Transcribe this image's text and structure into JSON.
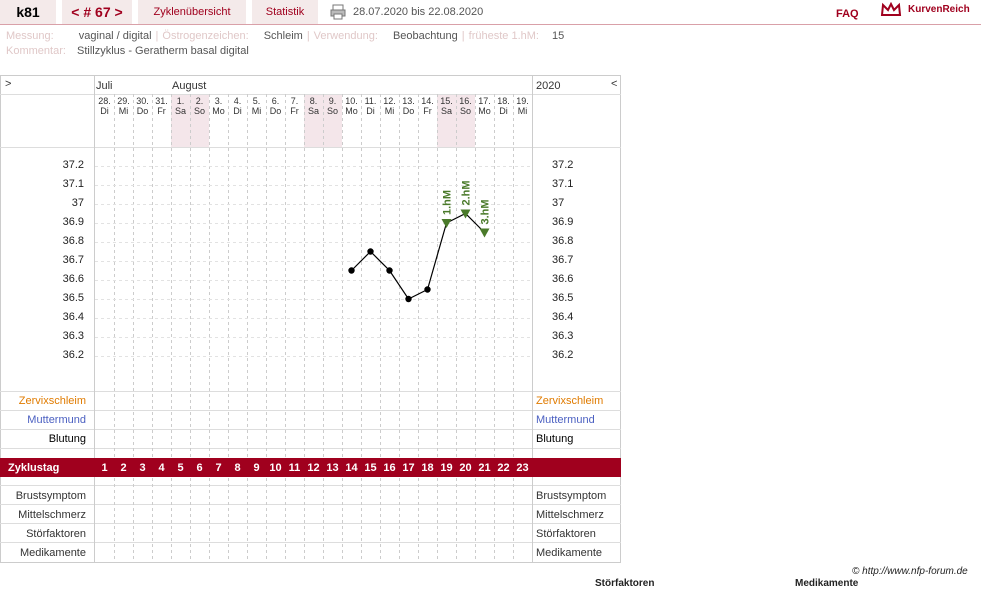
{
  "nav": {
    "user": "k81",
    "cycle": "< # 67 >",
    "tab_overview": "Zyklenübersicht",
    "tab_stats": "Statistik",
    "date_range": "28.07.2020 bis 22.08.2020",
    "faq": "FAQ",
    "brand": "KurvenReich"
  },
  "info": {
    "messung_label": "Messung:",
    "messung_value": "vaginal / digital",
    "oestrogen_label": "Östrogenzeichen:",
    "oestrogen_value": "Schleim",
    "verwendung_label": "Verwendung:",
    "verwendung_value": "Beobachtung",
    "frueheste_label": "früheste 1.hM:",
    "frueheste_value": "15",
    "kommentar_label": "Kommentar:",
    "kommentar_value": "Stillzyklus - Geratherm basal digital"
  },
  "chart_header": {
    "left_arrow": ">",
    "right_arrow": "<",
    "year": "2020",
    "month1": "Juli",
    "month2": "August"
  },
  "days": [
    {
      "d": "28.",
      "w": "Di"
    },
    {
      "d": "29.",
      "w": "Mi"
    },
    {
      "d": "30.",
      "w": "Do"
    },
    {
      "d": "31.",
      "w": "Fr"
    },
    {
      "d": "1.",
      "w": "Sa"
    },
    {
      "d": "2.",
      "w": "So"
    },
    {
      "d": "3.",
      "w": "Mo"
    },
    {
      "d": "4.",
      "w": "Di"
    },
    {
      "d": "5.",
      "w": "Mi"
    },
    {
      "d": "6.",
      "w": "Do"
    },
    {
      "d": "7.",
      "w": "Fr"
    },
    {
      "d": "8.",
      "w": "Sa"
    },
    {
      "d": "9.",
      "w": "So"
    },
    {
      "d": "10.",
      "w": "Mo"
    },
    {
      "d": "11.",
      "w": "Di"
    },
    {
      "d": "12.",
      "w": "Mi"
    },
    {
      "d": "13.",
      "w": "Do"
    },
    {
      "d": "14.",
      "w": "Fr"
    },
    {
      "d": "15.",
      "w": "Sa"
    },
    {
      "d": "16.",
      "w": "So"
    },
    {
      "d": "17.",
      "w": "Mo"
    },
    {
      "d": "18.",
      "w": "Di"
    },
    {
      "d": "19.",
      "w": "Mi"
    }
  ],
  "chart_data": {
    "type": "line",
    "ylim": [
      36.1,
      37.3
    ],
    "yticks": [
      "37.2",
      "37.1",
      "37",
      "36.9",
      "36.8",
      "36.7",
      "36.6",
      "36.5",
      "36.4",
      "36.3",
      "36.2"
    ],
    "cycle_days": [
      14,
      15,
      16,
      17,
      18,
      19,
      20,
      21
    ],
    "temperatures": [
      36.65,
      36.75,
      36.65,
      36.5,
      36.55,
      36.9,
      36.95,
      36.85
    ],
    "high_markers": [
      {
        "cycle_day": 19,
        "label": "1.hM"
      },
      {
        "cycle_day": 20,
        "label": "2.hM"
      },
      {
        "cycle_day": 21,
        "label": "3.hM"
      }
    ],
    "colors": {
      "line": "#000000",
      "marker": "#4a7a2a",
      "label": "#4a7a2a"
    }
  },
  "rows": {
    "zervix": "Zervixschleim",
    "muttermund": "Muttermund",
    "blutung": "Blutung",
    "zyklustag": "Zyklustag",
    "brust": "Brustsymptom",
    "mittel": "Mittelschmerz",
    "stoer": "Störfaktoren",
    "medi": "Medikamente"
  },
  "zyklustage": [
    "1",
    "2",
    "3",
    "4",
    "5",
    "6",
    "7",
    "8",
    "9",
    "10",
    "11",
    "12",
    "13",
    "14",
    "15",
    "16",
    "17",
    "18",
    "19",
    "20",
    "21",
    "22",
    "23"
  ],
  "footer": {
    "copyright": "© http://www.nfp-forum.de",
    "bottom_left": "Störfaktoren",
    "bottom_right": "Medikamente"
  },
  "colors": {
    "accent": "#a0001e",
    "weekend": "#f4e6ea",
    "zervix": "#e07b00",
    "muttermund": "#4a5fc1"
  }
}
